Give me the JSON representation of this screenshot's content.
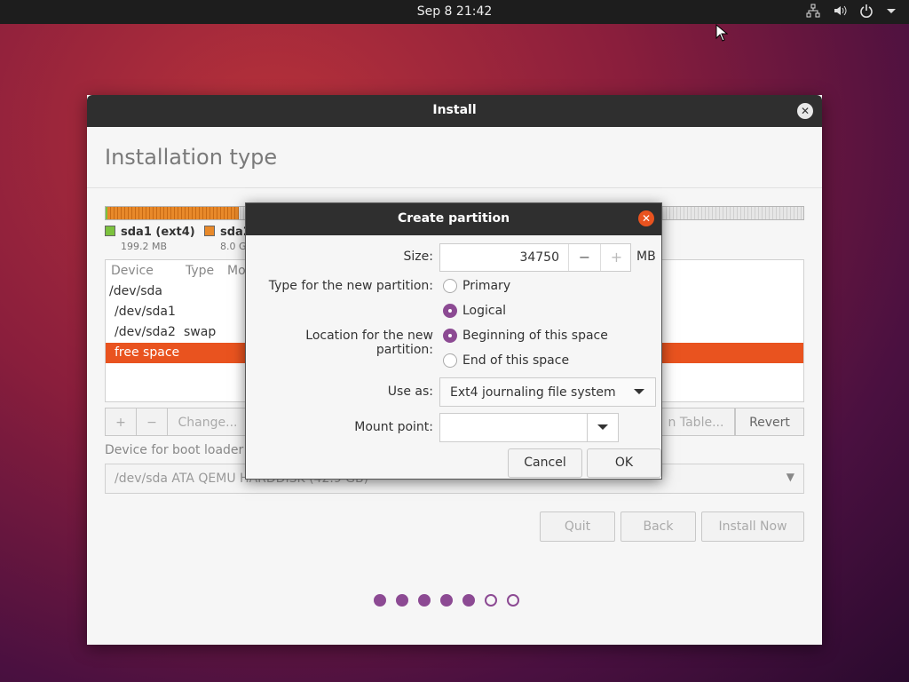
{
  "topbar": {
    "clock": "Sep 8  21:42",
    "tray_icons": [
      "network-icon",
      "volume-icon",
      "power-icon",
      "menu-arrow-icon"
    ]
  },
  "window": {
    "title": "Install",
    "heading": "Installation type"
  },
  "legend": [
    {
      "name": "sda1 (ext4)",
      "size": "199.2 MB",
      "color": "#7cc23e"
    },
    {
      "name": "sda2",
      "size": "8.0 G",
      "color": "#e8892a"
    }
  ],
  "table": {
    "headers": [
      "Device",
      "Type",
      "Mo"
    ],
    "rows": [
      {
        "device": "/dev/sda",
        "type": ""
      },
      {
        "device": "/dev/sda1",
        "type": ""
      },
      {
        "device": "/dev/sda2",
        "type": "swap"
      },
      {
        "device": "free space",
        "type": "",
        "selected": true
      }
    ]
  },
  "table_buttons": {
    "add": "+",
    "remove": "−",
    "change": "Change...",
    "new_table": "n Table...",
    "revert": "Revert"
  },
  "bootloader": {
    "label": "Device for boot loader i",
    "value": "/dev/sda    ATA QEMU HARDDISK (42.9 GB)"
  },
  "nav": {
    "quit": "Quit",
    "back": "Back",
    "install": "Install Now"
  },
  "progress": {
    "filled": 5,
    "total": 7
  },
  "dialog": {
    "title": "Create partition",
    "size_label": "Size:",
    "size_value": "34750",
    "size_unit": "MB",
    "minus": "−",
    "plus": "+",
    "type_label": "Type for the new partition:",
    "type_options": [
      {
        "label": "Primary",
        "selected": false
      },
      {
        "label": "Logical",
        "selected": true
      }
    ],
    "location_label": "Location for the new partition:",
    "location_options": [
      {
        "label": "Beginning of this space",
        "selected": true
      },
      {
        "label": "End of this space",
        "selected": false
      }
    ],
    "useas_label": "Use as:",
    "useas_value": "Ext4 journaling file system",
    "mount_label": "Mount point:",
    "mount_value": "",
    "cancel": "Cancel",
    "ok": "OK"
  },
  "colors": {
    "accent": "#e9531f",
    "aubergine": "#8c4a93",
    "titlebar": "#2f2f2f"
  }
}
